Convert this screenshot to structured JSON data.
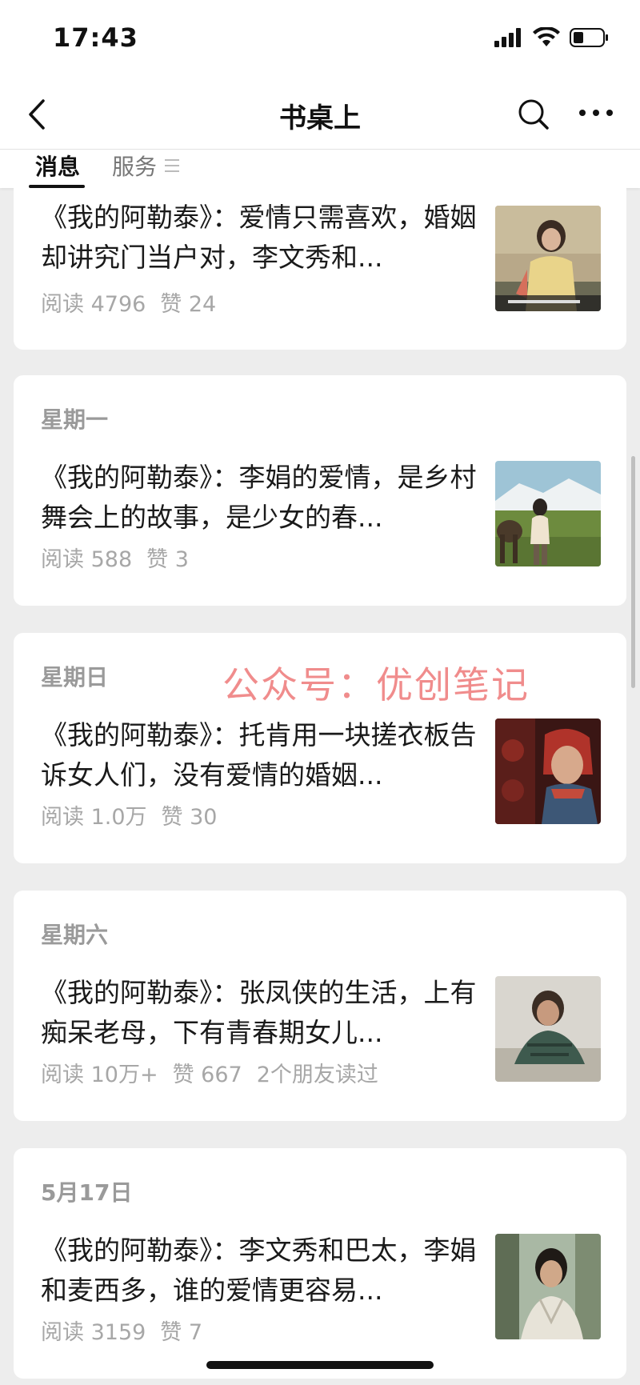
{
  "status": {
    "time": "17:43"
  },
  "nav": {
    "title": "书桌上"
  },
  "tabs": {
    "messages": "消息",
    "services": "服务"
  },
  "watermark": "公众号：优创笔记",
  "articles": [
    {
      "date": "",
      "title": "《我的阿勒泰》：爱情只需喜欢，婚姻却讲究门当户对，李文秀和...",
      "reads": "阅读 4796",
      "likes": "赞 24",
      "friends": "",
      "thumb_icon": "woman-in-field-photo"
    },
    {
      "date": "星期一",
      "title": "《我的阿勒泰》：李娟的爱情，是乡村舞会上的故事，是少女的春...",
      "reads": "阅读 588",
      "likes": "赞 3",
      "friends": "",
      "thumb_icon": "horse-and-rider-photo"
    },
    {
      "date": "星期日",
      "title": "《我的阿勒泰》：托肯用一块搓衣板告诉女人们，没有爱情的婚姻...",
      "reads": "阅读 1.0万",
      "likes": "赞 30",
      "friends": "",
      "thumb_icon": "woman-with-headscarf-photo"
    },
    {
      "date": "星期六",
      "title": "《我的阿勒泰》：张凤侠的生活，上有痴呆老母，下有青春期女儿...",
      "reads": "阅读 10万+",
      "likes": "赞 667",
      "friends": "2个朋友读过",
      "thumb_icon": "smiling-woman-photo"
    },
    {
      "date": "5月17日",
      "title": "《我的阿勒泰》：李文秀和巴太，李娟和麦西多，谁的爱情更容易...",
      "reads": "阅读 3159",
      "likes": "赞 7",
      "friends": "",
      "thumb_icon": "young-man-photo"
    }
  ]
}
